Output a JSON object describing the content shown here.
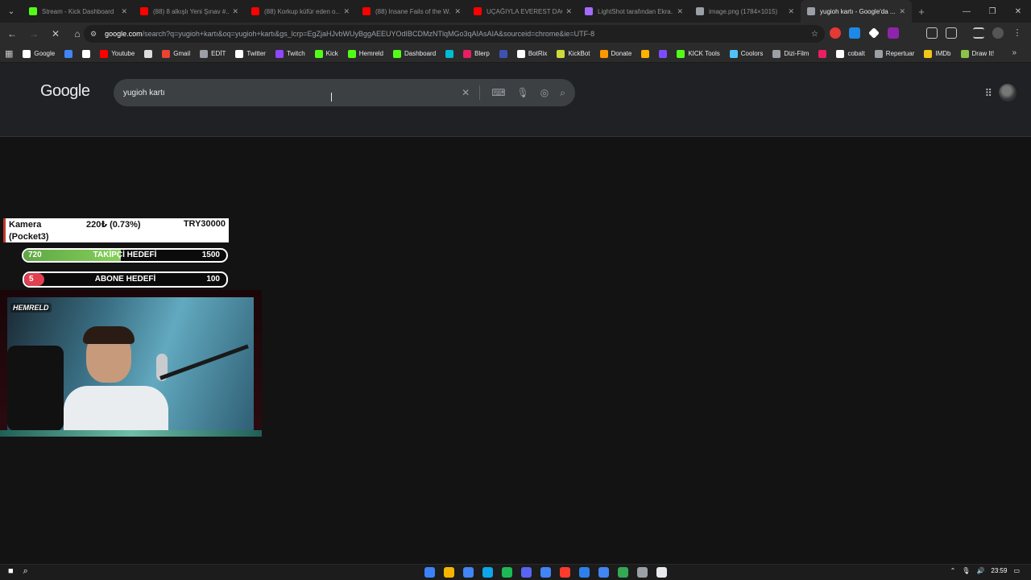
{
  "tabs": [
    {
      "title": "Stream - Kick Dashboard",
      "color": "#53fc18",
      "active": false
    },
    {
      "title": "(88) 8 alkışlı Yeni Şınav #...",
      "color": "#ff0000",
      "active": false
    },
    {
      "title": "(88) Korkup küfür eden o...",
      "color": "#ff0000",
      "active": false
    },
    {
      "title": "(88) Insane Fails of the W...",
      "color": "#ff0000",
      "active": false
    },
    {
      "title": "UÇAĞIYLA EVEREST DAĞ...",
      "color": "#ff0000",
      "active": false
    },
    {
      "title": "LightShot tarafından Ekra...",
      "color": "#a46bff",
      "active": false
    },
    {
      "title": "image.png (1784×1015)",
      "color": "#9aa0a6",
      "active": false
    },
    {
      "title": "yugioh kartı - Google'da ...",
      "color": "#9aa0a6",
      "active": true
    }
  ],
  "address": {
    "domain": "google.com",
    "path": "/search?q=yugioh+kartı&oq=yugioh+kartı&gs_lcrp=EgZjaHJvbWUyBggAEEUYOdIBCDMzNTlqMGo3qAIAsAIA&sourceid=chrome&ie=UTF-8"
  },
  "bookmarks": [
    {
      "label": "Google",
      "color": "#ffffff"
    },
    {
      "label": "",
      "color": "#4285f4"
    },
    {
      "label": "",
      "color": "#ffffff"
    },
    {
      "label": "Youtube",
      "color": "#ff0000"
    },
    {
      "label": "",
      "color": "#dddddd"
    },
    {
      "label": "Gmail",
      "color": "#ea4335"
    },
    {
      "label": "EDİT",
      "color": "#9aa0a6"
    },
    {
      "label": "Twitter",
      "color": "#ffffff"
    },
    {
      "label": "Twitch",
      "color": "#9146ff"
    },
    {
      "label": "Kick",
      "color": "#53fc18"
    },
    {
      "label": "Hemreld",
      "color": "#53fc18"
    },
    {
      "label": "Dashboard",
      "color": "#53fc18"
    },
    {
      "label": "",
      "color": "#00bcd4"
    },
    {
      "label": "Blerp",
      "color": "#e91e63"
    },
    {
      "label": "",
      "color": "#3f51b5"
    },
    {
      "label": "BotRix",
      "color": "#ffffff"
    },
    {
      "label": "KickBot",
      "color": "#cddc39"
    },
    {
      "label": "Donate",
      "color": "#ff9800"
    },
    {
      "label": "",
      "color": "#ffb300"
    },
    {
      "label": "",
      "color": "#7c4dff"
    },
    {
      "label": "KICK Tools",
      "color": "#53fc18"
    },
    {
      "label": "Coolors",
      "color": "#4fc3f7"
    },
    {
      "label": "Dizi-Film",
      "color": "#9aa0a6"
    },
    {
      "label": "",
      "color": "#e91e63"
    },
    {
      "label": "cobalt",
      "color": "#ffffff"
    },
    {
      "label": "Repertuar",
      "color": "#9aa0a6"
    },
    {
      "label": "IMDb",
      "color": "#f5c518"
    },
    {
      "label": "Draw It!",
      "color": "#8bc34a"
    }
  ],
  "google": {
    "logo": "Google",
    "query": "yugioh kartı"
  },
  "overlay": {
    "goal_name": "Kamera (Pocket3)",
    "goal_progress": "220₺ (0.73%)",
    "goal_target": "TRY30000",
    "follower_current": "720",
    "follower_label": "TAKİPÇİ HEDEFİ",
    "follower_target": "1500",
    "follower_fill": 0.48,
    "sub_current": "5",
    "sub_label": "ABONE HEDEFİ",
    "sub_target": "100",
    "sub_fill": 0.05,
    "cam_badge": "HEMRELD"
  },
  "taskbar": {
    "time": "23:59",
    "apps": [
      "#3b82f6",
      "#f5b400",
      "#4285f4",
      "#0ea5e9",
      "#1db954",
      "#5865f2",
      "#4285f4",
      "#ff3b30",
      "#2f80ed",
      "#4285f4",
      "#34a853",
      "#9aa0a6",
      "#e8eaed"
    ]
  }
}
